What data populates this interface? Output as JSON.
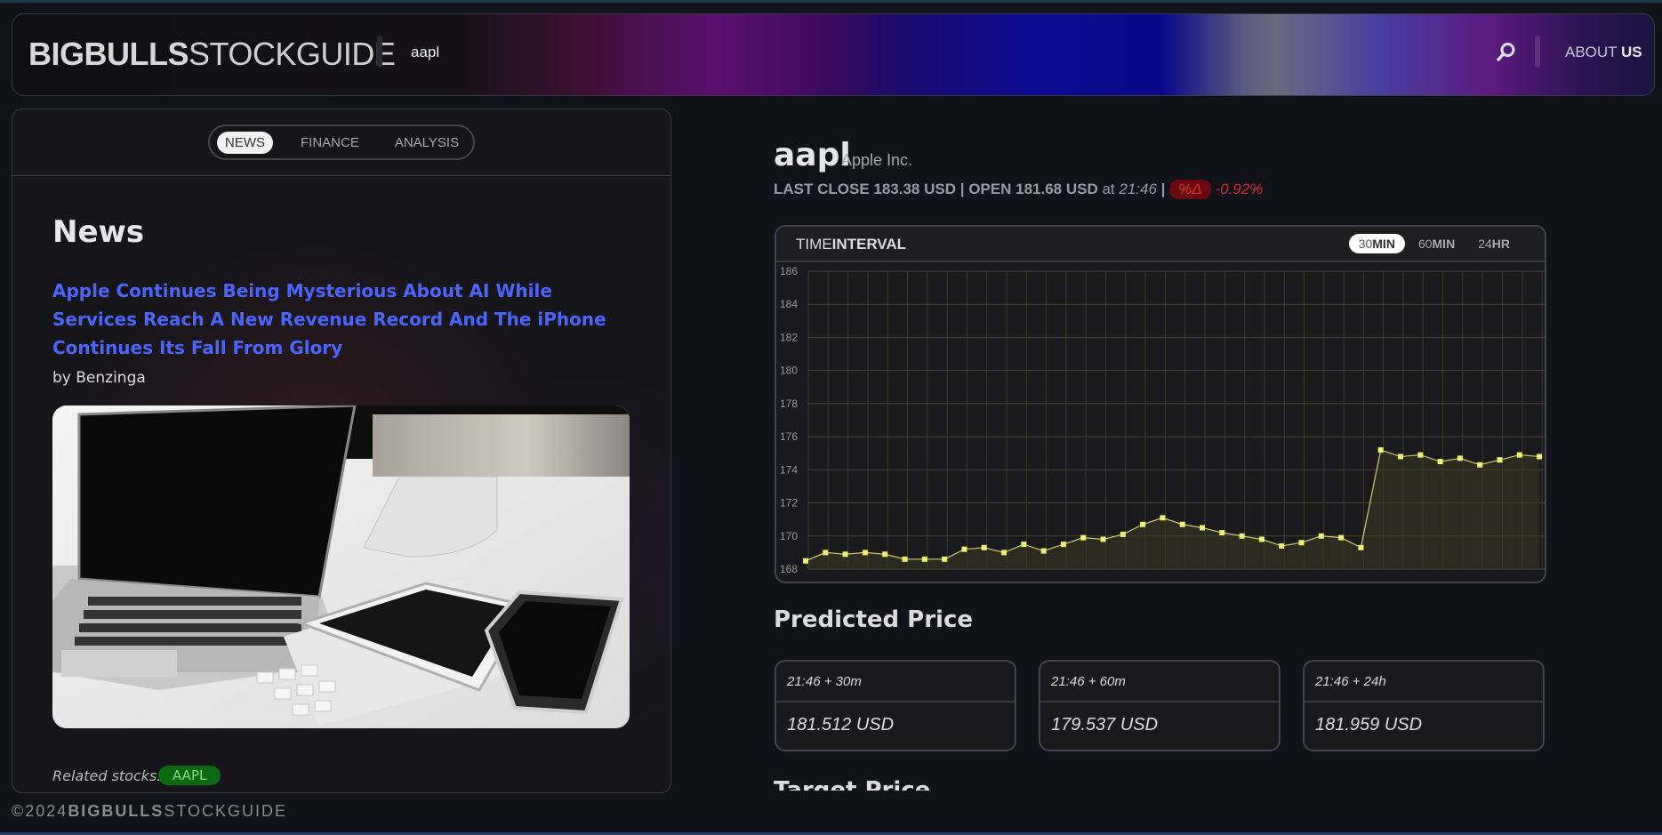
{
  "header": {
    "logo_bold": "BIGBULLS",
    "logo_thin": "STOCKGUIDE",
    "search_value": "aapl",
    "about_prefix": "ABOUT",
    "about_bold": "US"
  },
  "news_panel": {
    "tabs": [
      "NEWS",
      "FINANCE",
      "ANALYSIS"
    ],
    "active_tab": "NEWS",
    "heading": "News",
    "article_title": "Apple Continues Being Mysterious About AI While Services Reach A New Revenue Record And The iPhone Continues Its Fall From Glory",
    "author": "by Benzinga",
    "related_label": "Related stocks:",
    "related_ticker": "AAPL"
  },
  "quote": {
    "ticker": "aapl",
    "company": "Apple Inc.",
    "last_close_label": "LAST CLOSE 183.38 USD | OPEN 181.68 USD",
    "at": "at",
    "time": "21:46",
    "sep": "|",
    "delta_badge": "%Δ",
    "delta_pct": "-0.92%"
  },
  "chart_panel": {
    "title_thin": "TIME",
    "title_bold": "INTERVAL",
    "intervals": [
      {
        "num": "30",
        "unit": "MIN",
        "active": true
      },
      {
        "num": "60",
        "unit": "MIN",
        "active": false
      },
      {
        "num": "24",
        "unit": "HR",
        "active": false
      }
    ]
  },
  "chart_data": {
    "type": "line",
    "ylim": [
      168,
      186
    ],
    "yticks": [
      186,
      184,
      182,
      180,
      178,
      176,
      174,
      172,
      170,
      168
    ],
    "values": [
      168.5,
      169.0,
      168.9,
      169.0,
      168.9,
      168.6,
      168.6,
      168.6,
      169.2,
      169.3,
      169.0,
      169.5,
      169.1,
      169.5,
      169.9,
      169.8,
      170.1,
      170.7,
      171.1,
      170.7,
      170.5,
      170.2,
      170.0,
      169.8,
      169.4,
      169.6,
      170.0,
      169.9,
      169.3,
      175.2,
      174.8,
      174.9,
      174.5,
      174.7,
      174.3,
      174.6,
      174.9,
      174.8
    ],
    "line_color": "#cccc70",
    "marker_color": "#f0f070",
    "fill_color": "#3a3a22"
  },
  "predictions": {
    "heading": "Predicted Price",
    "items": [
      {
        "label": "21:46 + 30m",
        "value": "181.512 USD"
      },
      {
        "label": "21:46 + 60m",
        "value": "179.537 USD"
      },
      {
        "label": "21:46 + 24h",
        "value": "181.959 USD"
      }
    ]
  },
  "target_heading": "Target Price",
  "footer": {
    "copy": "©2024",
    "bold": "BIGBULLS",
    "thin": "STOCKGUIDE"
  }
}
